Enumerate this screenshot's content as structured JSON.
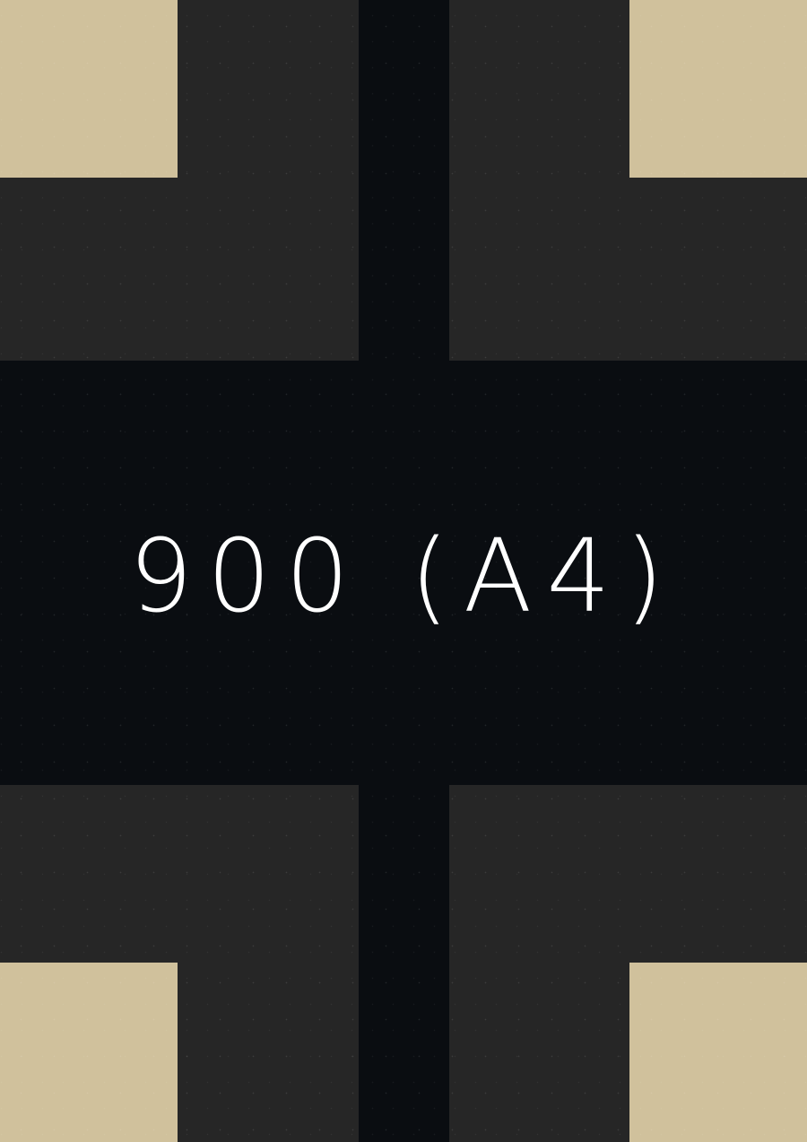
{
  "label": {
    "text": "900 (A4)"
  },
  "colors": {
    "background": "#0a0d11",
    "panel": "#262626",
    "corner": "#d0c19c",
    "text": "#ffffff"
  }
}
